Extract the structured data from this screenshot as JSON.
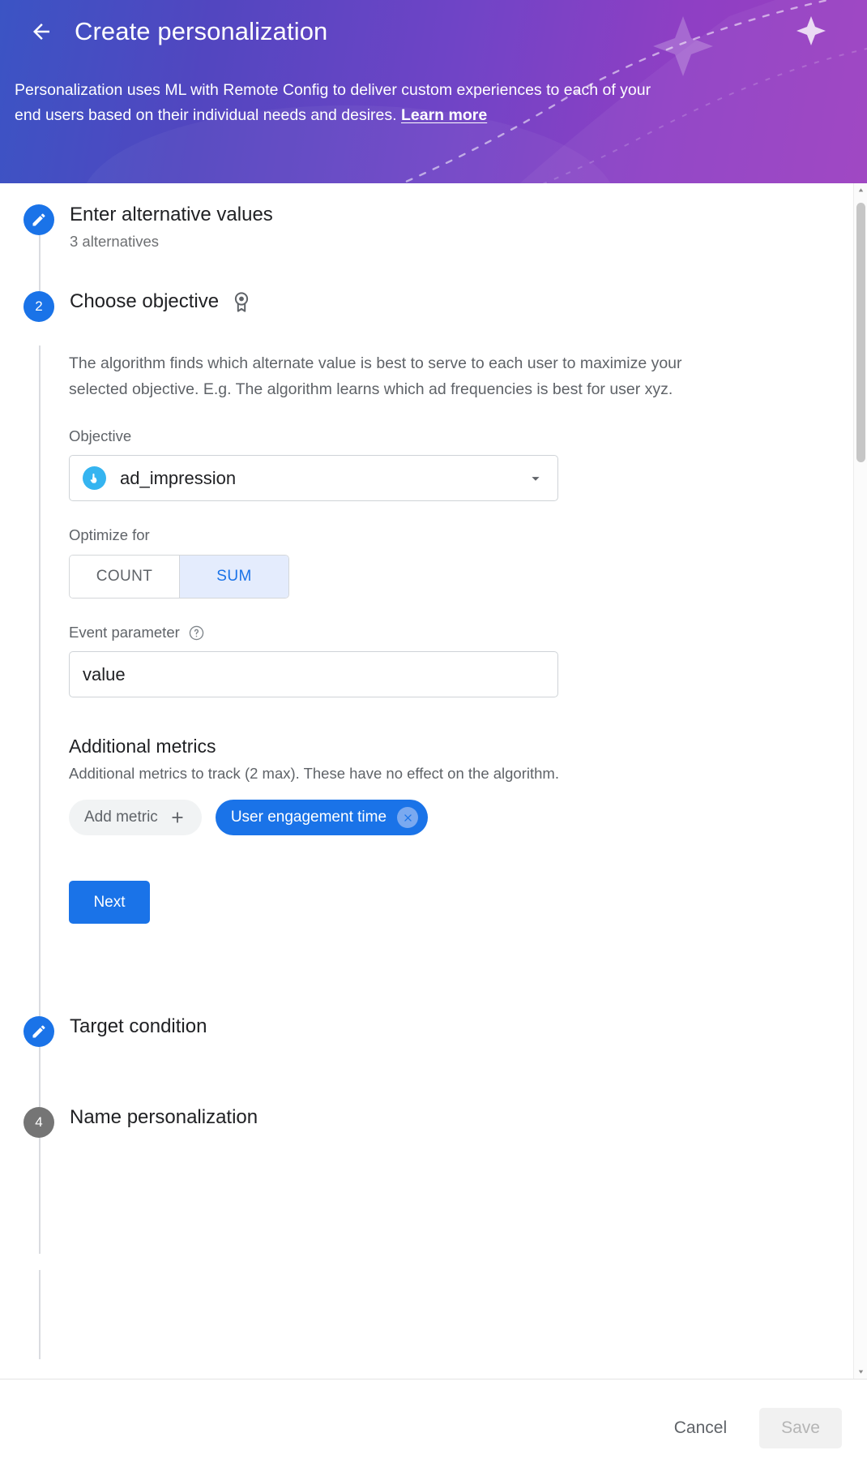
{
  "header": {
    "back_icon": "arrow-left-icon",
    "title": "Create personalization",
    "description_part1": "Personalization uses ML with Remote Config to deliver custom experiences to each of your end users based on their individual needs and desires. ",
    "learn_more": "Learn more"
  },
  "steps": [
    {
      "marker": "pencil-icon",
      "state": "done",
      "title": "Enter alternative values",
      "subtitle": "3 alternatives"
    },
    {
      "marker": "2",
      "state": "active",
      "title": "Choose objective",
      "icon": "medal-icon"
    },
    {
      "marker": "pencil-icon",
      "state": "done",
      "title": "Target condition"
    },
    {
      "marker": "4",
      "state": "idle",
      "title": "Name personalization"
    }
  ],
  "objective_step": {
    "description": "The algorithm finds which alternate value is best to serve to each user to maximize your selected objective. E.g. The algorithm learns which ad frequencies is best for user xyz.",
    "objective_label": "Objective",
    "objective_value": "ad_impression",
    "objective_icon": "touch-pointer-icon",
    "dropdown_icon": "chevron-down-icon",
    "optimize_label": "Optimize for",
    "optimize_options": [
      {
        "label": "COUNT",
        "selected": false
      },
      {
        "label": "SUM",
        "selected": true
      }
    ],
    "event_param_label": "Event parameter",
    "event_param_help_icon": "help-circle-icon",
    "event_param_value": "value",
    "additional_metrics_title": "Additional metrics",
    "additional_metrics_desc": "Additional metrics to track (2 max). These have no effect on the algorithm.",
    "add_metric_label": "Add metric",
    "add_metric_icon": "plus-icon",
    "metric_chip_label": "User engagement time",
    "metric_chip_remove_icon": "close-circle-icon",
    "next_label": "Next"
  },
  "footer": {
    "cancel_label": "Cancel",
    "save_label": "Save"
  },
  "scrollbar": {
    "up_icon": "caret-up-icon",
    "down_icon": "caret-down-icon"
  },
  "colors": {
    "accent_blue": "#1a73e8",
    "banner_start": "#3b54c4",
    "banner_end": "#9b3fc0",
    "toggle_selected_bg": "#e4ecfd",
    "idle_marker": "#757575"
  }
}
